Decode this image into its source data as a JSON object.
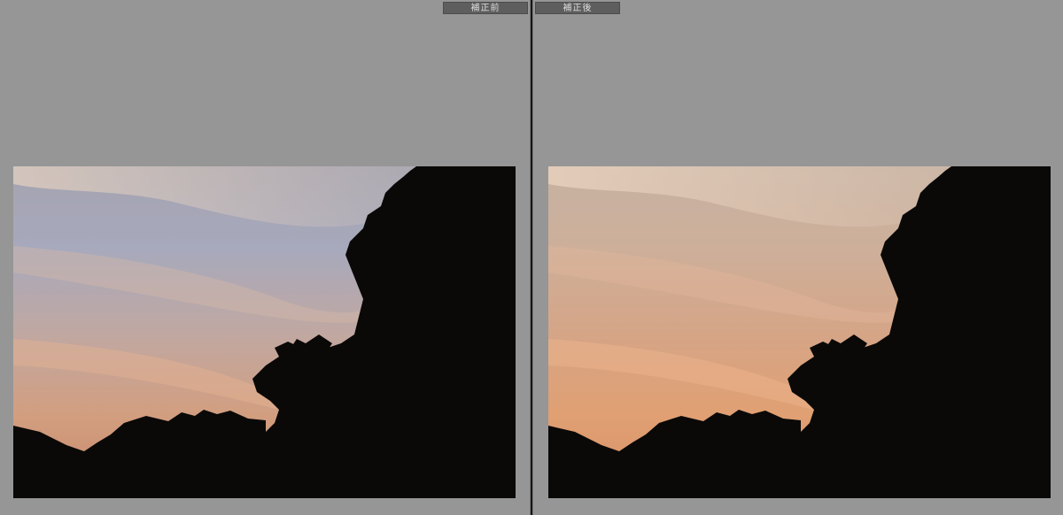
{
  "panes": {
    "before": {
      "label": "補正前",
      "colors": {
        "sky_top": "#8c98b3",
        "sky_mid": "#b5a6a8",
        "sky_low": "#d3a081",
        "horizon": "#c98a6a"
      }
    },
    "after": {
      "label": "補正後",
      "colors": {
        "sky_top": "#c3ab98",
        "sky_mid": "#d1a386",
        "sky_low": "#e0a174",
        "horizon": "#d98f68"
      }
    }
  },
  "colors": {
    "background": "#959595",
    "divider": "#161616",
    "label_bg": "#5e5e5e",
    "label_text": "#dedede",
    "silhouette": "#0a0908"
  }
}
